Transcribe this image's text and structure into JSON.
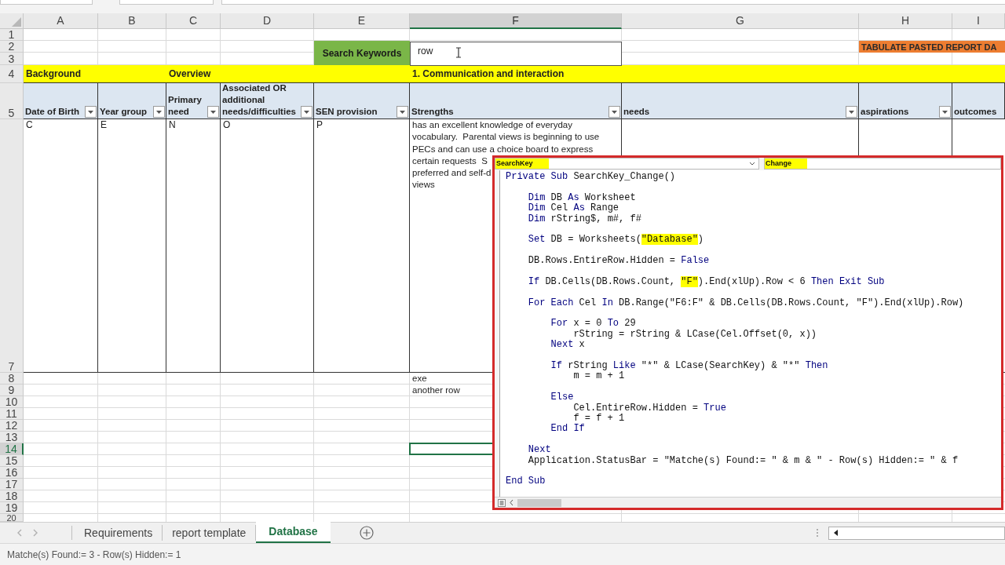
{
  "columns": [
    {
      "label": "A",
      "selected": false
    },
    {
      "label": "B",
      "selected": false
    },
    {
      "label": "C",
      "selected": false
    },
    {
      "label": "D",
      "selected": false
    },
    {
      "label": "E",
      "selected": false
    },
    {
      "label": "F",
      "selected": true
    },
    {
      "label": "G",
      "selected": false
    },
    {
      "label": "H",
      "selected": false
    },
    {
      "label": "I",
      "selected": false
    }
  ],
  "rows": [
    {
      "label": "1",
      "selected": false
    },
    {
      "label": "2",
      "selected": false
    },
    {
      "label": "3",
      "selected": false
    },
    {
      "label": "4",
      "selected": false
    },
    {
      "label": "5",
      "selected": false
    },
    {
      "label": "7",
      "selected": false
    },
    {
      "label": "8",
      "selected": false
    },
    {
      "label": "9",
      "selected": false
    },
    {
      "label": "10",
      "selected": false
    },
    {
      "label": "11",
      "selected": false
    },
    {
      "label": "12",
      "selected": false
    },
    {
      "label": "13",
      "selected": false
    },
    {
      "label": "14",
      "selected": true
    },
    {
      "label": "15",
      "selected": false
    },
    {
      "label": "16",
      "selected": false
    },
    {
      "label": "17",
      "selected": false
    },
    {
      "label": "18",
      "selected": false
    },
    {
      "label": "19",
      "selected": false
    },
    {
      "label": "20",
      "selected": false
    }
  ],
  "search": {
    "label": "Search Keywords",
    "value": "row"
  },
  "tabulate_button": "TABULATE PASTED REPORT DA",
  "section_headings": [
    "Background",
    "Overview",
    "1. Communication and interaction"
  ],
  "headers": [
    {
      "text": "Date of Birth",
      "filter": true
    },
    {
      "text": "Year group",
      "filter": true
    },
    {
      "text": "Primary need",
      "filter": true
    },
    {
      "text": "Associated OR additional needs/difficulties",
      "filter": true
    },
    {
      "text": "SEN provision",
      "filter": true
    },
    {
      "text": "Strengths",
      "filter": true
    },
    {
      "text": "needs",
      "filter": true
    },
    {
      "text": "aspirations",
      "filter": true
    },
    {
      "text": "outcomes",
      "filter": false
    }
  ],
  "record": {
    "cells": [
      "C",
      "E",
      "N",
      "O",
      "P"
    ],
    "strengths": [
      "has an excellent knowledge of everyday",
      "vocabulary.  Parental views is beginning to use",
      "PECs and can use a choice board to express",
      "certain requests  S",
      "preferred and self-d",
      "views"
    ]
  },
  "more_strengths": [
    "exe",
    "another row"
  ],
  "vba": {
    "object": {
      "text": "SearchKey",
      "highlighted": true
    },
    "procedure": {
      "text": "Change",
      "highlighted": true
    },
    "code": [
      [
        [
          {
            "kind": "kw",
            "text": "Private Sub"
          },
          {
            "kind": "plain",
            "text": " SearchKey_Change()"
          }
        ]
      ],
      [
        [
          {
            "kind": "kw",
            "text": "    Dim"
          },
          {
            "kind": "plain",
            "text": " DB "
          },
          {
            "kind": "kw",
            "text": "As"
          },
          {
            "kind": "plain",
            "text": " Worksheet"
          }
        ],
        [
          {
            "kind": "kw",
            "text": "    Dim"
          },
          {
            "kind": "plain",
            "text": " Cel "
          },
          {
            "kind": "kw",
            "text": "As"
          },
          {
            "kind": "plain",
            "text": " Range"
          }
        ],
        [
          {
            "kind": "kw",
            "text": "    Dim"
          },
          {
            "kind": "plain",
            "text": " rString$, m#, f#"
          }
        ]
      ],
      [
        [
          {
            "kind": "kw",
            "text": "    Set"
          },
          {
            "kind": "plain",
            "text": " DB = Worksheets("
          },
          {
            "kind": "mark",
            "text": "\"Database\""
          },
          {
            "kind": "plain",
            "text": ")"
          }
        ]
      ],
      [
        [
          {
            "kind": "plain",
            "text": "    DB.Rows.EntireRow.Hidden = "
          },
          {
            "kind": "kw",
            "text": "False"
          }
        ]
      ],
      [
        [
          {
            "kind": "kw",
            "text": "    If"
          },
          {
            "kind": "plain",
            "text": " DB.Cells(DB.Rows.Count, "
          },
          {
            "kind": "mark",
            "text": "\"F\""
          },
          {
            "kind": "plain",
            "text": ").End(xlUp).Row < 6 "
          },
          {
            "kind": "kw",
            "text": "Then Exit Sub"
          }
        ]
      ],
      [
        [
          {
            "kind": "kw",
            "text": "    For Each"
          },
          {
            "kind": "plain",
            "text": " Cel "
          },
          {
            "kind": "kw",
            "text": "In"
          },
          {
            "kind": "plain",
            "text": " DB.Range(\"F6:F\" & DB.Cells(DB.Rows.Count, \"F\").End(xlUp).Row)"
          }
        ]
      ],
      [
        [
          {
            "kind": "kw",
            "text": "        For"
          },
          {
            "kind": "plain",
            "text": " x = 0 "
          },
          {
            "kind": "kw",
            "text": "To"
          },
          {
            "kind": "plain",
            "text": " 29"
          }
        ],
        [
          {
            "kind": "plain",
            "text": "            rString = rString & LCase(Cel.Offset(0, x))"
          }
        ],
        [
          {
            "kind": "kw",
            "text": "        Next"
          },
          {
            "kind": "plain",
            "text": " x"
          }
        ]
      ],
      [
        [
          {
            "kind": "kw",
            "text": "        If"
          },
          {
            "kind": "plain",
            "text": " rString "
          },
          {
            "kind": "kw",
            "text": "Like"
          },
          {
            "kind": "plain",
            "text": " \"*\" & LCase(SearchKey) & \"*\" "
          },
          {
            "kind": "kw",
            "text": "Then"
          }
        ],
        [
          {
            "kind": "plain",
            "text": "            m = m + 1"
          }
        ]
      ],
      [
        [
          {
            "kind": "kw",
            "text": "        Else"
          }
        ],
        [
          {
            "kind": "plain",
            "text": "            Cel.EntireRow.Hidden = "
          },
          {
            "kind": "kw",
            "text": "True"
          }
        ],
        [
          {
            "kind": "plain",
            "text": "            f = f + 1"
          }
        ],
        [
          {
            "kind": "kw",
            "text": "        End If"
          }
        ]
      ],
      [
        [
          {
            "kind": "kw",
            "text": "    Next"
          }
        ],
        [
          {
            "kind": "plain",
            "text": "    Application.StatusBar = \"Matche(s) Found:= \" & m & \" - Row(s) Hidden:= \" & f"
          }
        ]
      ],
      [
        [
          {
            "kind": "kw",
            "text": "End Sub"
          }
        ]
      ]
    ]
  },
  "sheet_tabs": [
    {
      "label": "Requirements",
      "selected": false
    },
    {
      "label": "report template",
      "selected": false
    },
    {
      "label": "Database",
      "selected": true
    }
  ],
  "status_bar": "Matche(s) Found:= 3 - Row(s) Hidden:= 1"
}
